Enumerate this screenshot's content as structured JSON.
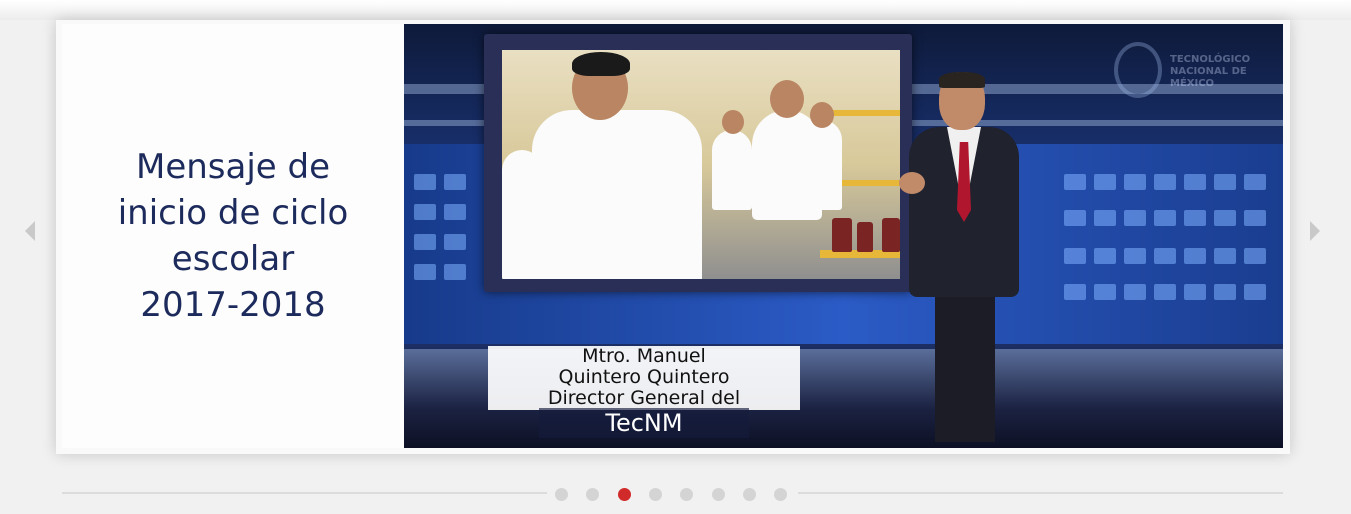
{
  "slider": {
    "slide_title": "Mensaje de\ninicio de ciclo\nescolar\n2017-2018",
    "lower_third": {
      "line1": "Mtro. Manuel",
      "line2": "Quintero Quintero",
      "line3": "Director General del",
      "line4": "TecNM"
    },
    "watermark": {
      "line1": "TECNOLÓGICO",
      "line2": "NACIONAL DE MÉXICO",
      "icon": "tecnm-logo-icon"
    },
    "prev_icon": "chevron-left-icon",
    "next_icon": "chevron-right-icon",
    "pager": {
      "total": 8,
      "active_index": 2
    }
  },
  "colors": {
    "title_text": "#1c2a5c",
    "active_dot": "#d12a2a",
    "inactive_dot": "#d4d4d4",
    "arrow": "#c9c9c9"
  }
}
